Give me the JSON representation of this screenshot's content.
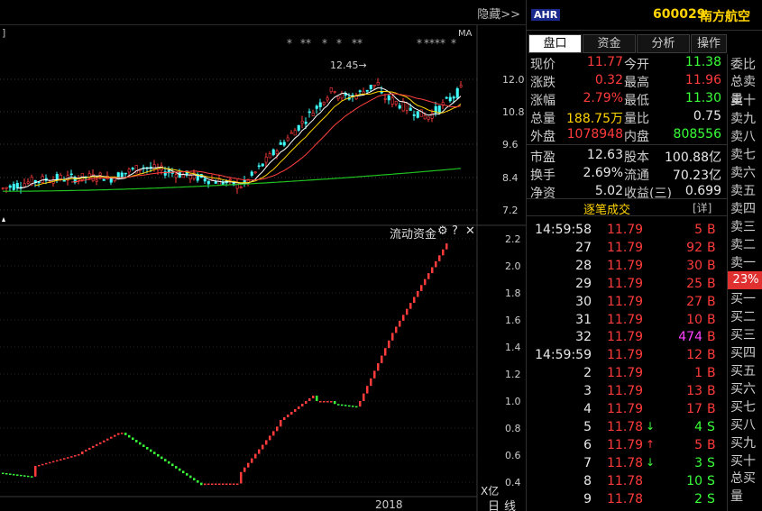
{
  "chart": {
    "hide_label": "隐藏>>",
    "ma_label": "MA",
    "peak_label": "12.45",
    "star_groups": [
      "*",
      "**",
      "*",
      "*",
      "**"
    ],
    "star_groups_right": [
      "*",
      "****",
      "*"
    ],
    "price_axis": [
      "12.0",
      "10.8",
      "9.6",
      "8.4",
      "7.2"
    ],
    "flow_label": "流动资金",
    "flow_axis": [
      "2.2",
      "2.0",
      "1.8",
      "1.6",
      "1.4",
      "1.2",
      "1.0",
      "0.8",
      "0.6",
      "0.4"
    ],
    "unit_label": "X亿",
    "year_label": "2018",
    "period_day": "日",
    "period_line": "线",
    "colors": {
      "up": "#ff3b3b",
      "down": "#39ff39",
      "ma5": "#ffffff",
      "ma10": "#ffd400",
      "ma20": "#ff4040",
      "ma120": "#20c020"
    }
  },
  "header": {
    "badge": "AHR",
    "code": "600029",
    "name": "南方航空"
  },
  "tabs": [
    "盘口",
    "资金",
    "分析",
    "操作"
  ],
  "quote": [
    {
      "l1": "现价",
      "v1": "11.77",
      "c1": "red",
      "l2": "今开",
      "v2": "11.38",
      "c2": "green"
    },
    {
      "l1": "涨跌",
      "v1": "0.32",
      "c1": "red",
      "l2": "最高",
      "v2": "11.96",
      "c2": "red"
    },
    {
      "l1": "涨幅",
      "v1": "2.79%",
      "c1": "red",
      "l2": "最低",
      "v2": "11.30",
      "c2": "green"
    },
    {
      "l1": "总量",
      "v1": "188.75万",
      "c1": "yellow",
      "l2": "量比",
      "v2": "0.75",
      "c2": "white"
    },
    {
      "l1": "外盘",
      "v1": "1078948",
      "c1": "red",
      "l2": "内盘",
      "v2": "808556",
      "c2": "green"
    },
    {
      "l1": "市盈",
      "v1": "12.63",
      "c1": "white",
      "l2": "股本",
      "v2": "100.88亿",
      "c2": "white"
    },
    {
      "l1": "换手",
      "v1": "2.69%",
      "c1": "white",
      "l2": "流通",
      "v2": "70.23亿",
      "c2": "white"
    },
    {
      "l1": "净资",
      "v1": "5.02",
      "c1": "white",
      "l2": "收益(三)",
      "v2": "0.699",
      "c2": "white"
    }
  ],
  "ticks": {
    "title": "逐笔成交",
    "detail": "[详]",
    "rows": [
      {
        "time": "14:59:58",
        "price": "11.79",
        "pc": "red",
        "arrow": "",
        "ac": "",
        "vol": "5",
        "vc": "red",
        "bs": "B",
        "bc": "red"
      },
      {
        "time": "27",
        "price": "11.79",
        "pc": "red",
        "arrow": "",
        "ac": "",
        "vol": "92",
        "vc": "red",
        "bs": "B",
        "bc": "red"
      },
      {
        "time": "28",
        "price": "11.79",
        "pc": "red",
        "arrow": "",
        "ac": "",
        "vol": "30",
        "vc": "red",
        "bs": "B",
        "bc": "red"
      },
      {
        "time": "29",
        "price": "11.79",
        "pc": "red",
        "arrow": "",
        "ac": "",
        "vol": "25",
        "vc": "red",
        "bs": "B",
        "bc": "red"
      },
      {
        "time": "30",
        "price": "11.79",
        "pc": "red",
        "arrow": "",
        "ac": "",
        "vol": "27",
        "vc": "red",
        "bs": "B",
        "bc": "red"
      },
      {
        "time": "31",
        "price": "11.79",
        "pc": "red",
        "arrow": "",
        "ac": "",
        "vol": "10",
        "vc": "red",
        "bs": "B",
        "bc": "red"
      },
      {
        "time": "32",
        "price": "11.79",
        "pc": "red",
        "arrow": "",
        "ac": "",
        "vol": "474",
        "vc": "purple",
        "bs": "B",
        "bc": "red"
      },
      {
        "time": "14:59:59",
        "price": "11.79",
        "pc": "red",
        "arrow": "",
        "ac": "",
        "vol": "12",
        "vc": "red",
        "bs": "B",
        "bc": "red"
      },
      {
        "time": "2",
        "price": "11.79",
        "pc": "red",
        "arrow": "",
        "ac": "",
        "vol": "1",
        "vc": "red",
        "bs": "B",
        "bc": "red"
      },
      {
        "time": "3",
        "price": "11.79",
        "pc": "red",
        "arrow": "",
        "ac": "",
        "vol": "13",
        "vc": "red",
        "bs": "B",
        "bc": "red"
      },
      {
        "time": "4",
        "price": "11.79",
        "pc": "red",
        "arrow": "",
        "ac": "",
        "vol": "17",
        "vc": "red",
        "bs": "B",
        "bc": "red"
      },
      {
        "time": "5",
        "price": "11.78",
        "pc": "red",
        "arrow": "↓",
        "ac": "green",
        "vol": "4",
        "vc": "green",
        "bs": "S",
        "bc": "green"
      },
      {
        "time": "6",
        "price": "11.79",
        "pc": "red",
        "arrow": "↑",
        "ac": "red",
        "vol": "5",
        "vc": "red",
        "bs": "B",
        "bc": "red"
      },
      {
        "time": "7",
        "price": "11.78",
        "pc": "red",
        "arrow": "↓",
        "ac": "green",
        "vol": "3",
        "vc": "green",
        "bs": "S",
        "bc": "green"
      },
      {
        "time": "8",
        "price": "11.78",
        "pc": "red",
        "arrow": "",
        "ac": "",
        "vol": "10",
        "vc": "green",
        "bs": "S",
        "bc": "green"
      },
      {
        "time": "9",
        "price": "11.78",
        "pc": "red",
        "arrow": "",
        "ac": "",
        "vol": "2",
        "vc": "green",
        "bs": "S",
        "bc": "green"
      }
    ]
  },
  "orderbook": {
    "weibi": "委比",
    "sell_total": "总卖量",
    "sells": [
      "卖十",
      "卖九",
      "卖八",
      "卖七",
      "卖六",
      "卖五",
      "卖四",
      "卖三",
      "卖二",
      "卖一"
    ],
    "pct": "23%",
    "buys": [
      "买一",
      "买二",
      "买三",
      "买四",
      "买五",
      "买六",
      "买七",
      "买八",
      "买九",
      "买十"
    ],
    "buy_total": "总买量"
  }
}
